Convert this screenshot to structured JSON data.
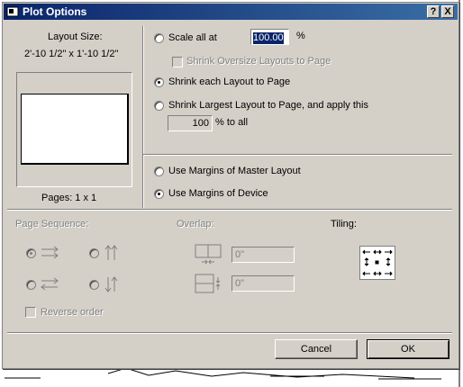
{
  "dialog": {
    "title": "Plot Options",
    "help_label": "?",
    "close_label": "X"
  },
  "left": {
    "layout_size_label": "Layout Size:",
    "layout_size_value": "2'-10 1/2\" x 1'-10 1/2\"",
    "pages_label": "Pages: 1 x 1"
  },
  "scaling": {
    "scale_all_label": "Scale all at",
    "scale_all_value": "100.00",
    "scale_percent": "%",
    "shrink_oversize_label": "Shrink Oversize Layouts to Page",
    "shrink_each_label": "Shrink each Layout to Page",
    "shrink_largest_label": "Shrink Largest Layout to Page, and apply this",
    "apply_value": "100",
    "apply_suffix": "% to all",
    "selected": "shrink_each"
  },
  "margins": {
    "master_label": "Use Margins of Master Layout",
    "device_label": "Use Margins of Device",
    "selected": "device"
  },
  "sequence": {
    "page_sequence_label": "Page Sequence:",
    "overlap_label": "Overlap:",
    "tiling_label": "Tiling:",
    "overlap_h_value": "0\"",
    "overlap_v_value": "0\"",
    "reverse_label": "Reverse order"
  },
  "buttons": {
    "cancel": "Cancel",
    "ok": "OK"
  }
}
